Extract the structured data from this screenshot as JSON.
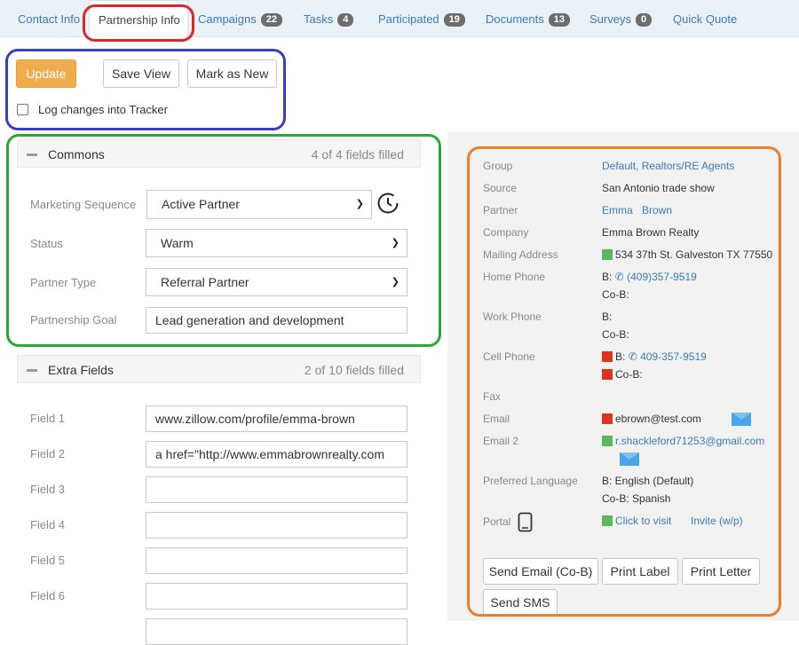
{
  "tabs": [
    {
      "label": "Contact Info",
      "count": null
    },
    {
      "label": "Partnership Info",
      "count": null
    },
    {
      "label": "Campaigns",
      "count": "22"
    },
    {
      "label": "Tasks",
      "count": "4"
    },
    {
      "label": "Participated",
      "count": "19"
    },
    {
      "label": "Documents",
      "count": "13"
    },
    {
      "label": "Surveys",
      "count": "0"
    },
    {
      "label": "Quick Quote",
      "count": null
    }
  ],
  "actions": {
    "update": "Update",
    "save_view": "Save View",
    "mark_as_new": "Mark as New",
    "log_changes": "Log changes into Tracker"
  },
  "commons": {
    "title": "Commons",
    "filled": "4 of 4 fields filled",
    "fields": {
      "marketing_sequence": {
        "label": "Marketing Sequence",
        "value": "Active Partner"
      },
      "status": {
        "label": "Status",
        "value": "Warm"
      },
      "partner_type": {
        "label": "Partner Type",
        "value": "Referral Partner"
      },
      "partnership_goal": {
        "label": "Partnership Goal",
        "value": "Lead generation and development"
      }
    }
  },
  "extra": {
    "title": "Extra Fields",
    "filled": "2 of 10 fields filled",
    "fields": [
      {
        "label": "Field 1",
        "value": "www.zillow.com/profile/emma-brown"
      },
      {
        "label": "Field 2",
        "value": "a href=\"http://www.emmabrownrealty.com"
      },
      {
        "label": "Field 3",
        "value": ""
      },
      {
        "label": "Field 4",
        "value": ""
      },
      {
        "label": "Field 5",
        "value": ""
      },
      {
        "label": "Field 6",
        "value": ""
      }
    ]
  },
  "contact": {
    "group": {
      "label": "Group",
      "value": "Default, Realtors/RE Agents"
    },
    "source": {
      "label": "Source",
      "value": "San Antonio trade show"
    },
    "partner": {
      "label": "Partner",
      "first": "Emma",
      "last": "Brown"
    },
    "company": {
      "label": "Company",
      "value": "Emma Brown Realty"
    },
    "mailing": {
      "label": "Mailing Address",
      "value": "534 37th St. Galveston TX 77550"
    },
    "home_phone": {
      "label": "Home Phone",
      "b": "B:",
      "b_value": "(409)357-9519",
      "cob": "Co-B:"
    },
    "work_phone": {
      "label": "Work Phone",
      "b": "B:",
      "cob": "Co-B:"
    },
    "cell_phone": {
      "label": "Cell Phone",
      "b": "B:",
      "b_value": "409-357-9519",
      "cob": "Co-B:"
    },
    "fax": {
      "label": "Fax"
    },
    "email": {
      "label": "Email",
      "value": "ebrown@test.com"
    },
    "email2": {
      "label": "Email 2",
      "value": "r.shackleford71253@gmail.com"
    },
    "language": {
      "label": "Preferred Language",
      "b": "B: English (Default)",
      "cob": "Co-B: Spanish"
    },
    "portal": {
      "label": "Portal",
      "visit": "Click to visit",
      "invite": "Invite (w/p)"
    }
  },
  "panel_buttons": {
    "send_email": "Send Email (Co-B)",
    "print_label": "Print Label",
    "print_letter": "Print Letter",
    "send_sms": "Send SMS"
  },
  "colors": {
    "link": "#3a7ab8",
    "primary_button": "#f0ad4e",
    "annotation_red": "#e0262a",
    "annotation_blue": "#3a3fbf",
    "annotation_green": "#2aa836",
    "annotation_orange": "#f07b2a"
  }
}
